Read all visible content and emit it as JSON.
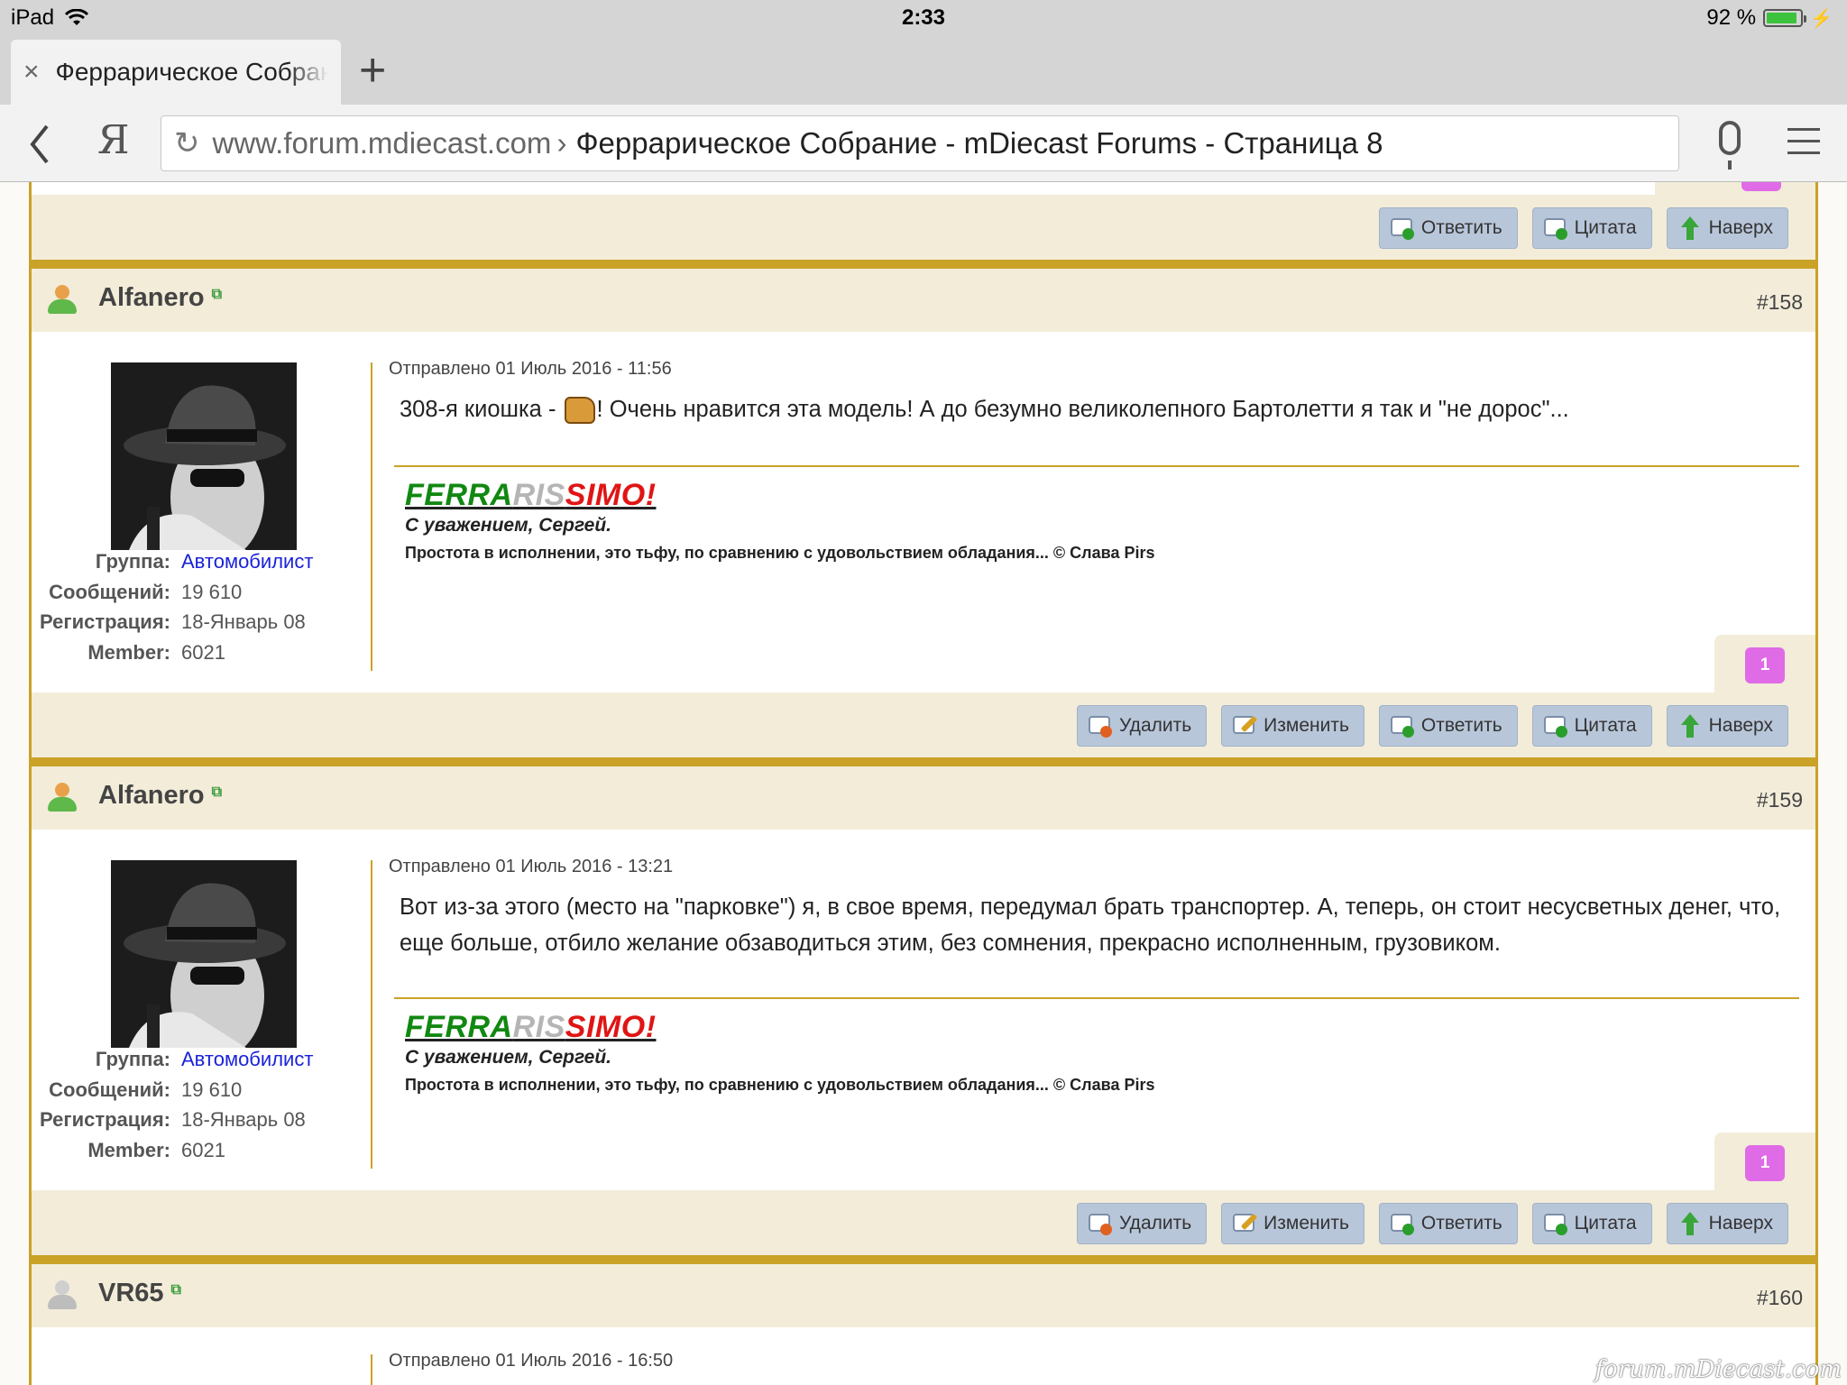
{
  "status_bar": {
    "device": "iPad",
    "time": "2:33",
    "battery": "92 %",
    "battery_level": 0.92
  },
  "browser": {
    "tab_title": "Феррарическое Собрание - mDiecast Forums - Страница 8",
    "new_tab_symbol": "+",
    "back_symbol": "‹",
    "yandex_logo": "Я",
    "url_domain": "www.forum.mdiecast.com",
    "url_separator": "›",
    "url_title": "Феррарическое Собрание - mDiecast Forums - Страница 8",
    "icons": [
      "close-icon",
      "plus-icon",
      "back-icon",
      "reload-icon",
      "microphone-icon",
      "hamburger-menu-icon"
    ]
  },
  "buttons": {
    "delete": "Удалить",
    "edit": "Изменить",
    "reply": "Ответить",
    "quote": "Цитата",
    "top": "Наверх"
  },
  "user_fields": {
    "group": "Группа:",
    "posts": "Сообщений:",
    "registered": "Регистрация:",
    "member": "Member:"
  },
  "signature": {
    "logo_green": "FERRA",
    "logo_silver": "RIS",
    "logo_red": "SIMO!",
    "line1": "С уважением, Сергей.",
    "line2": "Простота в исполнении, это тьфу, по сравнению с удовольствием обладания... © Слава Pirs"
  },
  "posts": [
    {
      "author": "Alfanero",
      "number": "#158",
      "meta": "Отправлено 01 Июль 2016 - 11:56",
      "body_before": "308-я киошка - ",
      "body_after": "! Очень нравится эта модель! А до безумно великолепного Бартолетти я так и \"не дорос\"...",
      "group": "Автомобилист",
      "posts": "19 610",
      "registered": "18-Январь 08",
      "member": "6021",
      "reputation": "1"
    },
    {
      "author": "Alfanero",
      "number": "#159",
      "meta": "Отправлено 01 Июль 2016 - 13:21",
      "body": "Вот из-за этого (место на \"парковке\") я, в свое время, передумал брать транспортер. А, теперь, он стоит несусветных денег, что, еще больше, отбило желание обзаводиться этим, без сомнения, прекрасно исполненным, грузовиком.",
      "group": "Автомобилист",
      "posts": "19 610",
      "registered": "18-Январь 08",
      "member": "6021",
      "reputation": "1"
    },
    {
      "author": "VR65",
      "number": "#160",
      "meta": "Отправлено 01 Июль 2016 - 16:50"
    }
  ],
  "watermark": "forum.mDiecast.com",
  "colors": {
    "accent_gold": "#c9a227",
    "header_bg": "#f2ecd9",
    "button_bg": "#b8c6da",
    "link_blue": "#1a22d8",
    "reputation_pink": "#e06be6"
  }
}
